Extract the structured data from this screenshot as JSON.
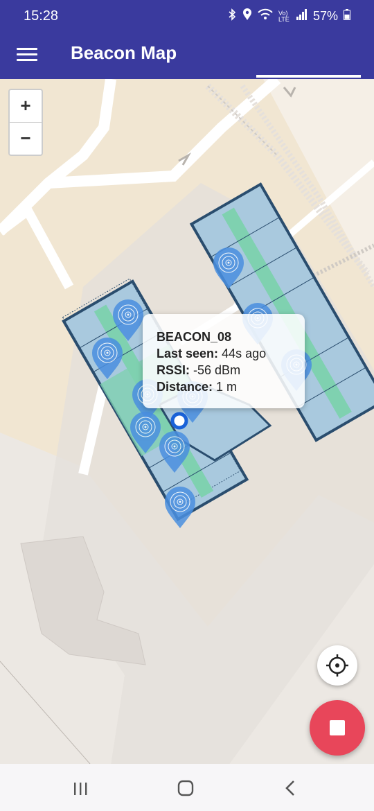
{
  "status": {
    "time": "15:28",
    "battery": "57%",
    "icons": [
      "bluetooth-icon",
      "location-icon",
      "wifi-call-icon",
      "volte-icon",
      "signal-icon",
      "battery-icon"
    ],
    "network_label": "Vo) LTE"
  },
  "app_bar": {
    "title": "Beacon Map",
    "menu_icon": "hamburger-menu-icon"
  },
  "progress": {
    "fraction": 0.28
  },
  "map": {
    "zoom_in": "+",
    "zoom_out": "−",
    "popup": {
      "title": "BEACON_08",
      "last_seen_label": "Last seen:",
      "last_seen_value": "44s ago",
      "rssi_label": "RSSI:",
      "rssi_value": "-56 dBm",
      "distance_label": "Distance:",
      "distance_value": "1 m"
    },
    "beacon_count": 9
  },
  "controls": {
    "locate_icon": "crosshair-icon",
    "stop_icon": "stop-icon"
  },
  "colors": {
    "primary": "#3a3a9e",
    "fab": "#e8465a",
    "beacon": "#4a8fe0",
    "building_outline": "#2a4d6e",
    "corridor": "#7fd1b0"
  },
  "nav": {
    "recents_icon": "recents-icon",
    "home_icon": "home-icon",
    "back_icon": "back-icon"
  }
}
